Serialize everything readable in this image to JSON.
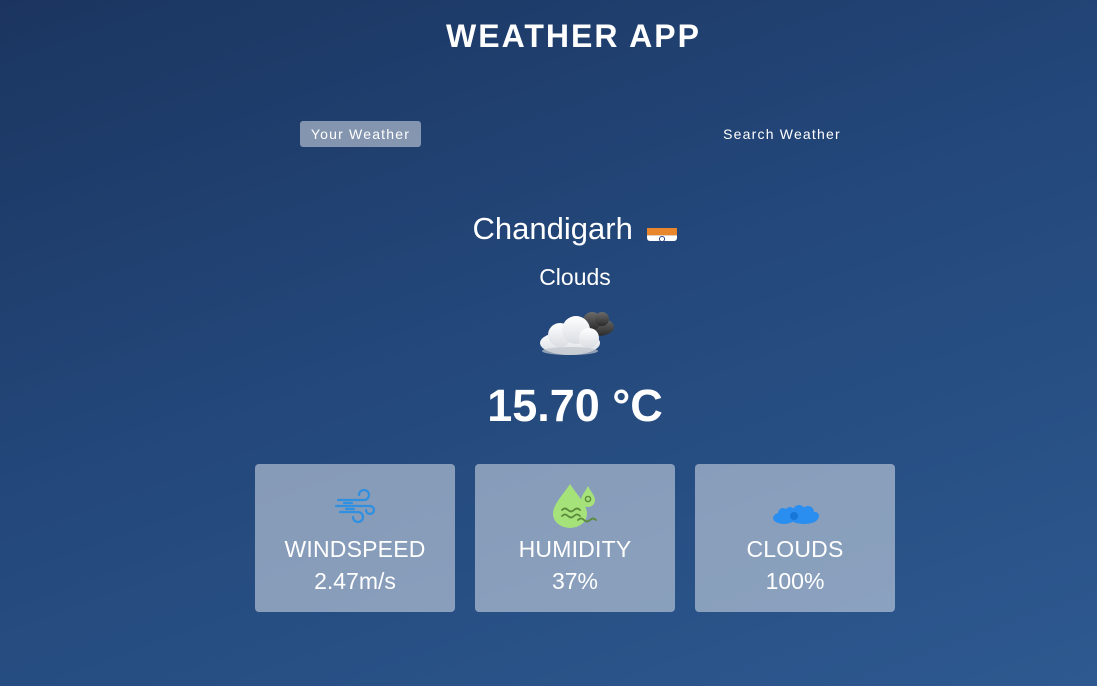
{
  "app": {
    "title": "WEATHER APP"
  },
  "tabs": [
    {
      "label": "Your Weather",
      "active": true
    },
    {
      "label": "Search Weather",
      "active": false
    }
  ],
  "weather": {
    "city": "Chandigarh",
    "country_flag_icon": "india-flag-icon",
    "condition": "Clouds",
    "condition_icon": "cloudy-night-icon",
    "temperature": "15.70 °C"
  },
  "cards": {
    "windspeed": {
      "label": "WINDSPEED",
      "value": "2.47m/s",
      "icon": "wind-icon"
    },
    "humidity": {
      "label": "HUMIDITY",
      "value": "37%",
      "icon": "humidity-icon"
    },
    "clouds": {
      "label": "CLOUDS",
      "value": "100%",
      "icon": "clouds-icon"
    }
  },
  "colors": {
    "background_top": "#1b3560",
    "background_bottom": "#2d5990",
    "card_background": "rgba(255,255,255,0.45)",
    "wind_icon": "#2f8fe0",
    "humidity_icon": "#a6e27a",
    "clouds_icon": "#2a8ef0"
  }
}
